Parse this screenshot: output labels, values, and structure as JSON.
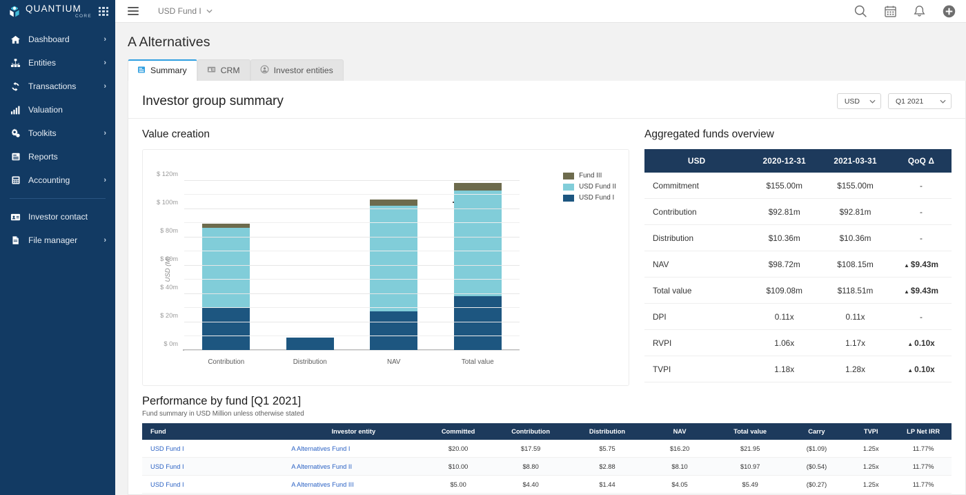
{
  "brand": {
    "name": "QUANTIUM",
    "sub": "CORE",
    "logo_icon": "cube-logo-icon",
    "apps_icon": "apps-grid-icon"
  },
  "sidebar": {
    "items": [
      {
        "label": "Dashboard",
        "icon": "home-icon",
        "chevron": "›"
      },
      {
        "label": "Entities",
        "icon": "sitemap-icon",
        "chevron": "›"
      },
      {
        "label": "Transactions",
        "icon": "refresh-icon",
        "chevron": "›"
      },
      {
        "label": "Valuation",
        "icon": "bar-chart-icon",
        "chevron": ""
      },
      {
        "label": "Toolkits",
        "icon": "gears-icon",
        "chevron": "›"
      },
      {
        "label": "Reports",
        "icon": "report-icon",
        "chevron": ""
      },
      {
        "label": "Accounting",
        "icon": "calculator-icon",
        "chevron": "›"
      }
    ],
    "items2": [
      {
        "label": "Investor contact",
        "icon": "contact-card-icon",
        "chevron": ""
      },
      {
        "label": "File manager",
        "icon": "file-icon",
        "chevron": "›"
      }
    ]
  },
  "topbar": {
    "menu_icon": "hamburger-icon",
    "fund_selector": "USD Fund I",
    "fund_caret": "⌄",
    "icons": [
      "search-icon",
      "calendar-icon",
      "bell-icon",
      "plus-circle-icon"
    ]
  },
  "page": {
    "title": "A Alternatives"
  },
  "tabs": [
    {
      "label": "Summary",
      "icon": "summary-icon",
      "active": true
    },
    {
      "label": "CRM",
      "icon": "crm-icon",
      "active": false
    },
    {
      "label": "Investor entities",
      "icon": "person-icon",
      "active": false
    }
  ],
  "summary": {
    "title": "Investor group summary",
    "currency_select": "USD",
    "period_select": "Q1 2021",
    "caret": "⌄"
  },
  "value_creation": {
    "title": "Value creation"
  },
  "overview": {
    "title": "Aggregated funds overview",
    "columns": [
      "USD",
      "2020-12-31",
      "2021-03-31",
      "QoQ Δ"
    ],
    "rows": [
      {
        "label": "Commitment",
        "c1": "$155.00m",
        "c2": "$155.00m",
        "delta": "-",
        "up": false
      },
      {
        "label": "Contribution",
        "c1": "$92.81m",
        "c2": "$92.81m",
        "delta": "-",
        "up": false
      },
      {
        "label": "Distribution",
        "c1": "$10.36m",
        "c2": "$10.36m",
        "delta": "-",
        "up": false
      },
      {
        "label": "NAV",
        "c1": "$98.72m",
        "c2": "$108.15m",
        "delta": "$9.43m",
        "up": true
      },
      {
        "label": "Total value",
        "c1": "$109.08m",
        "c2": "$118.51m",
        "delta": "$9.43m",
        "up": true
      },
      {
        "label": "DPI",
        "c1": "0.11x",
        "c2": "0.11x",
        "delta": "-",
        "up": false
      },
      {
        "label": "RVPI",
        "c1": "1.06x",
        "c2": "1.17x",
        "delta": "0.10x",
        "up": true
      },
      {
        "label": "TVPI",
        "c1": "1.18x",
        "c2": "1.28x",
        "delta": "0.10x",
        "up": true
      }
    ]
  },
  "performance": {
    "title": "Performance by fund [Q1 2021]",
    "subtitle": "Fund summary in USD Million unless otherwise stated",
    "columns": [
      "Fund",
      "Investor entity",
      "Committed",
      "Contribution",
      "Distribution",
      "NAV",
      "Total value",
      "Carry",
      "TVPI",
      "LP Net IRR"
    ],
    "rows": [
      {
        "fund": "USD Fund I",
        "entity": "A Alternatives Fund I",
        "committed": "$20.00",
        "contribution": "$17.59",
        "distribution": "$5.75",
        "nav": "$16.20",
        "total": "$21.95",
        "carry": "($1.09)",
        "tvpi": "1.25x",
        "irr": "11.77%"
      },
      {
        "fund": "USD Fund I",
        "entity": "A Alternatives Fund II",
        "committed": "$10.00",
        "contribution": "$8.80",
        "distribution": "$2.88",
        "nav": "$8.10",
        "total": "$10.97",
        "carry": "($0.54)",
        "tvpi": "1.25x",
        "irr": "11.77%"
      },
      {
        "fund": "USD Fund I",
        "entity": "A Alternatives Fund III",
        "committed": "$5.00",
        "contribution": "$4.40",
        "distribution": "$1.44",
        "nav": "$4.05",
        "total": "$5.49",
        "carry": "($0.27)",
        "tvpi": "1.25x",
        "irr": "11.77%"
      }
    ]
  },
  "chart_data": {
    "type": "bar",
    "stacked": true,
    "title": "Value creation",
    "xlabel": "",
    "ylabel": "USD (M)",
    "ylim": [
      0,
      130
    ],
    "yticks": [
      0,
      20,
      40,
      60,
      80,
      100,
      120
    ],
    "ytick_labels": [
      "$ 0m",
      "$ 20m",
      "$ 40m",
      "$ 60m",
      "$ 80m",
      "$ 100m",
      "$ 120m"
    ],
    "grid": true,
    "legend_position": "right",
    "categories": [
      "Contribution",
      "Distribution",
      "NAV",
      "Total value"
    ],
    "series": [
      {
        "name": "USD Fund I",
        "color": "#1d5680",
        "values": [
          30.9,
          9.1,
          27.8,
          38.3
        ]
      },
      {
        "name": "USD Fund II",
        "color": "#81cdd9",
        "values": [
          55.6,
          0.0,
          74.7,
          74.6
        ]
      },
      {
        "name": "Fund III",
        "color": "#6d6b4d",
        "values": [
          3.3,
          0.25,
          4.2,
          5.6
        ]
      }
    ],
    "legend_order": [
      "Fund III",
      "USD Fund II",
      "USD Fund I"
    ],
    "colors": {
      "fund1": "#1d5680",
      "fund2": "#81cdd9",
      "fund3": "#6d6b4d"
    }
  },
  "colors": {
    "sidebar_bg": "#123a63",
    "table_header": "#1d3a5c",
    "accent_tab": "#2f9fe0",
    "positive": "#15a049",
    "link": "#2b62c4"
  }
}
